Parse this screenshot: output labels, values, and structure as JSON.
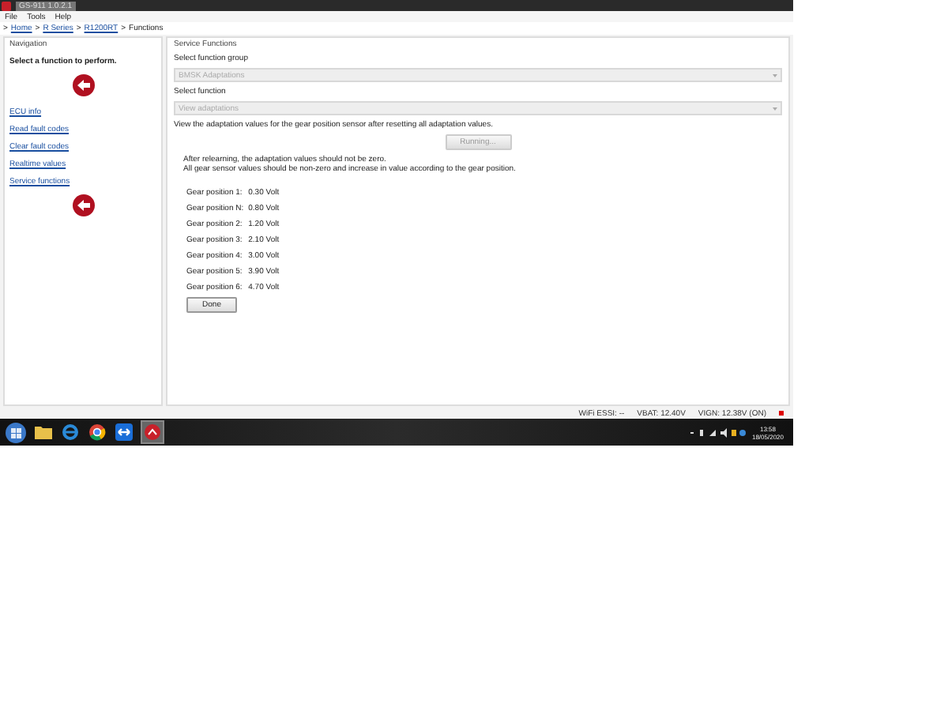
{
  "window": {
    "title": "GS-911 1.0.2.1"
  },
  "menu": [
    "File",
    "Tools",
    "Help"
  ],
  "breadcrumb": [
    {
      "kind": "separator",
      "text": ">"
    },
    {
      "kind": "link",
      "text": "Home"
    },
    {
      "kind": "separator",
      "text": ">"
    },
    {
      "kind": "link",
      "text": "R Series"
    },
    {
      "kind": "separator",
      "text": ">"
    },
    {
      "kind": "link",
      "text": "R1200RT"
    },
    {
      "kind": "separator",
      "text": ">"
    },
    {
      "kind": "current",
      "text": "Functions"
    }
  ],
  "navigation": {
    "title": "Navigation",
    "prompt": "Select a function to perform.",
    "items": [
      "ECU info",
      "Read fault codes",
      "Clear fault codes",
      "Realtime values",
      "Service functions"
    ]
  },
  "service_functions": {
    "title": "Service Functions",
    "group_label": "Select function group",
    "group_value": "BMSK Adaptations",
    "function_label": "Select function",
    "function_value": "View adaptations",
    "description": "View the adaptation values for the gear position sensor after resetting all adaptation values.",
    "running_button": {
      "label": "Running...",
      "disabled": true
    },
    "notes": [
      "After relearning, the adaptation values should not be zero.",
      "All gear sensor values should be non-zero and increase in value according to the gear position."
    ],
    "readings": [
      {
        "label": "Gear position 1:",
        "value": "0.30 Volt"
      },
      {
        "label": "Gear position N:",
        "value": "0.80 Volt"
      },
      {
        "label": "Gear position 2:",
        "value": "1.20 Volt"
      },
      {
        "label": "Gear position 3:",
        "value": "2.10 Volt"
      },
      {
        "label": "Gear position 4:",
        "value": "3.00 Volt"
      },
      {
        "label": "Gear position 5:",
        "value": "3.90 Volt"
      },
      {
        "label": "Gear position 6:",
        "value": "4.70 Volt"
      }
    ],
    "done_button": "Done"
  },
  "status_bar": [
    "WiFi ESSI: --",
    "VBAT: 12.40V",
    "VIGN: 12.38V (ON)"
  ],
  "taskbar": {
    "time": "13:58",
    "date": "18/05/2020"
  }
}
